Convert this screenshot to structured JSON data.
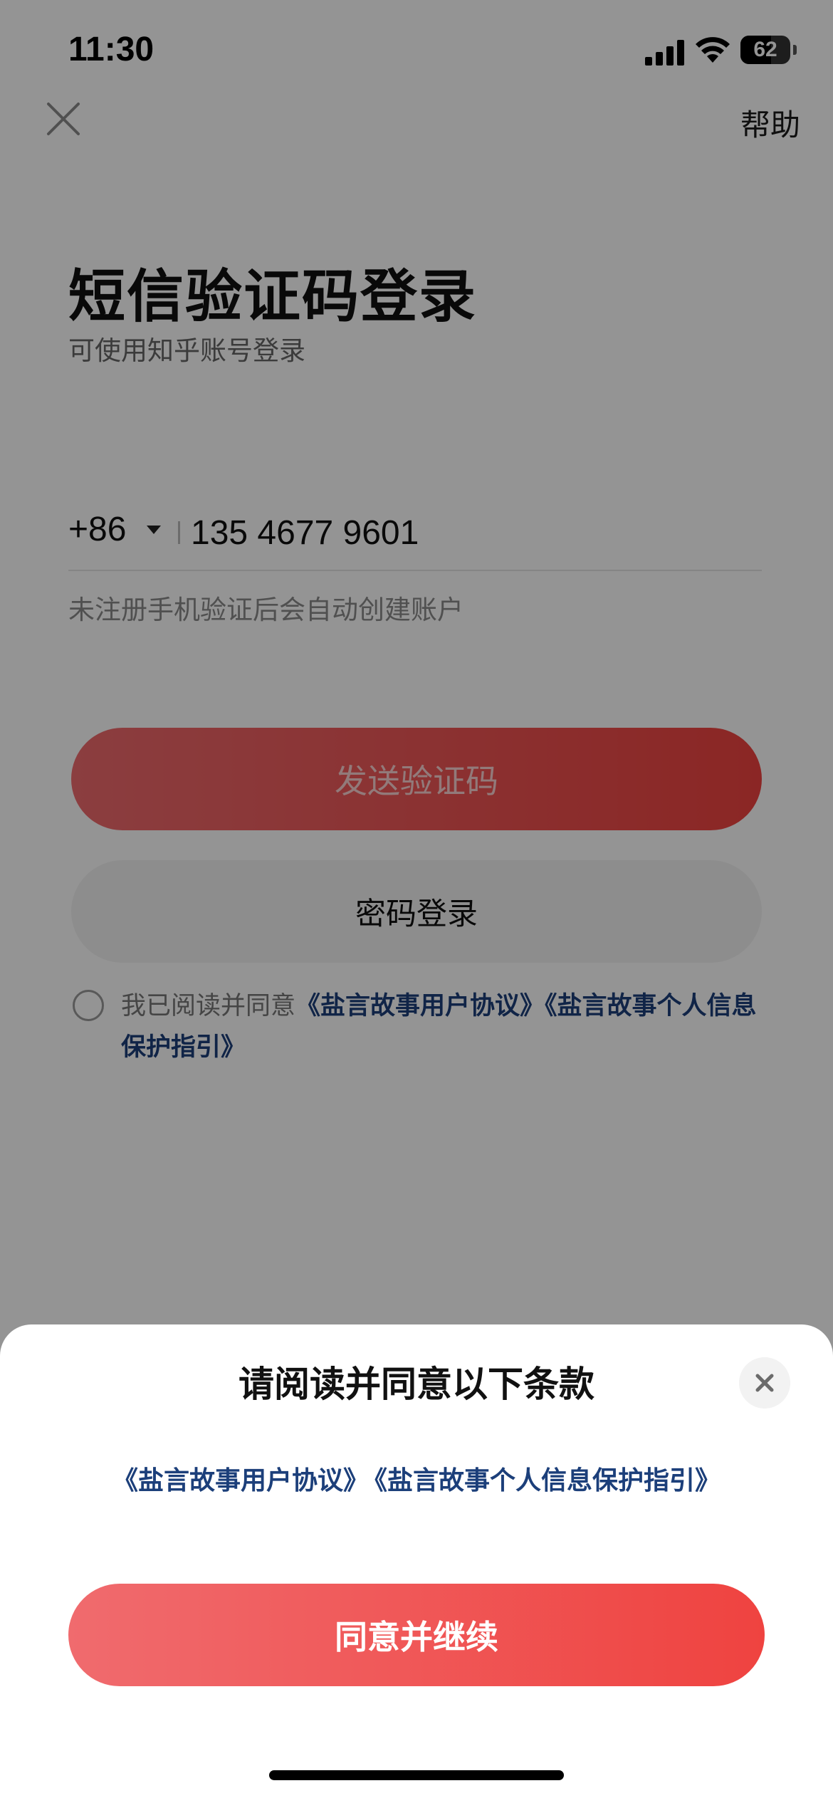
{
  "status_bar": {
    "time": "11:30",
    "battery_text": "62",
    "battery_level": 0.62,
    "signal_icon": "cellular-signal-icon",
    "wifi_icon": "wifi-icon"
  },
  "nav": {
    "close_icon": "close-icon",
    "help_label": "帮助"
  },
  "login": {
    "title": "短信验证码登录",
    "subtitle": "可使用知乎账号登录",
    "country_code": "+86",
    "phone_value": "135 4677 9601",
    "hint": "未注册手机验证后会自动创建账户",
    "send_code_label": "发送验证码",
    "password_login_label": "密码登录",
    "agreement_prefix": "我已阅读并同意",
    "agreement_link_1": "《盐言故事用户协议》",
    "agreement_link_2": "《盐言故事个人信息保护指引》"
  },
  "sheet": {
    "title": "请阅读并同意以下条款",
    "link_1": "《盐言故事用户协议》",
    "link_2": "《盐言故事个人信息保护指引》",
    "continue_label": "同意并继续"
  },
  "colors": {
    "accent_red": "#ef4340",
    "link_blue": "#1c3f7a"
  }
}
